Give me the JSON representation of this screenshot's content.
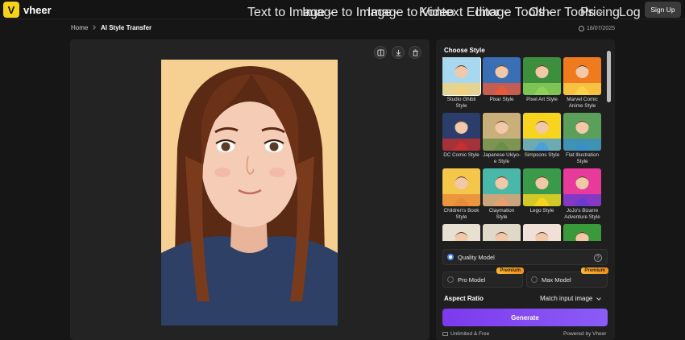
{
  "brand": {
    "name": "vheer",
    "logo_letter": "V"
  },
  "nav": {
    "items": [
      {
        "label": "Text to Image",
        "dropdown": true
      },
      {
        "label": "Image to Image",
        "dropdown": true
      },
      {
        "label": "Image to Video",
        "dropdown": false
      },
      {
        "label": "Kontext Editor",
        "dropdown": true
      },
      {
        "label": "Image Tools",
        "dropdown": true
      },
      {
        "label": "Other Tools",
        "dropdown": true
      },
      {
        "label": "Pricing",
        "dropdown": false
      }
    ],
    "login": "Log In",
    "signup": "Sign Up"
  },
  "breadcrumb": {
    "home": "Home",
    "current": "AI Style Transfer"
  },
  "date": "18/07/2025",
  "preview": {
    "tools": [
      "compare-icon",
      "download-icon",
      "trash-icon"
    ]
  },
  "styles": {
    "title": "Choose Style",
    "selected": "Studio Ghibli Style",
    "items": [
      {
        "label": "Studio Ghibli Style",
        "c1": "#a8d8f0",
        "c2": "#f4d27a"
      },
      {
        "label": "Pixar Style",
        "c1": "#3a6fb5",
        "c2": "#e85a3a"
      },
      {
        "label": "Pixel Art Style",
        "c1": "#3d8f3d",
        "c2": "#8fd15a"
      },
      {
        "label": "Marvel Comic Anime Style",
        "c1": "#f07a1e",
        "c2": "#fbd34a"
      },
      {
        "label": "DC Comic Style",
        "c1": "#2b3d6a",
        "c2": "#c43030"
      },
      {
        "label": "Japanese Ukiyo-e Style",
        "c1": "#c9b07a",
        "c2": "#6a8f4a"
      },
      {
        "label": "Simpsons Style",
        "c1": "#f7d51e",
        "c2": "#4aa0d8"
      },
      {
        "label": "Flat Illustration Style",
        "c1": "#5aa05a",
        "c2": "#3a8fc8"
      },
      {
        "label": "Children's Book Style",
        "c1": "#f4c64a",
        "c2": "#e88a3a"
      },
      {
        "label": "Claymation Style",
        "c1": "#4ab8a8",
        "c2": "#e8a070"
      },
      {
        "label": "Lego Style",
        "c1": "#3a9a4a",
        "c2": "#f7d51e"
      },
      {
        "label": "JoJo's Bizarre Adventure Style",
        "c1": "#e83a9a",
        "c2": "#6a3ad0"
      },
      {
        "label": "",
        "c1": "#e8e0d0",
        "c2": "#3a3a3a"
      },
      {
        "label": "",
        "c1": "#e0d8c8",
        "c2": "#5a7a3a"
      },
      {
        "label": "",
        "c1": "#f0e0d8",
        "c2": "#c85a5a"
      },
      {
        "label": "",
        "c1": "#3a9a3a",
        "c2": "#f7d51e"
      }
    ]
  },
  "models": {
    "quality": "Quality Model",
    "pro": "Pro Model",
    "max": "Max Model",
    "premium_badge": "Premium",
    "selected": "Quality Model"
  },
  "aspect_ratio": {
    "label": "Aspect Ratio",
    "value": "Match input image"
  },
  "generate_label": "Generate",
  "footer": {
    "left": "Unlimited & Free",
    "right": "Powered by Vheer"
  },
  "colors": {
    "accent": "#7c3aed",
    "premium": "#f7b733",
    "brand": "#f6d21b"
  }
}
